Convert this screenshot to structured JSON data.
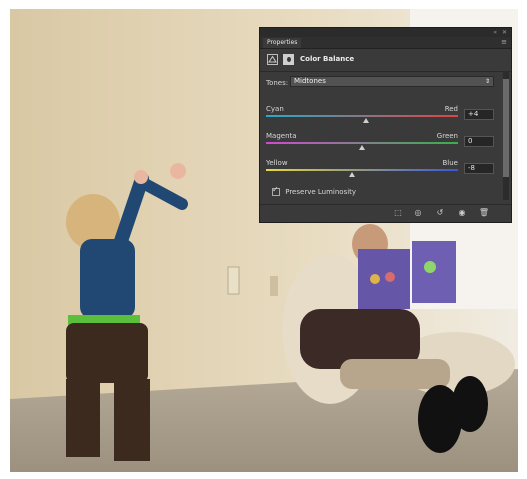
{
  "panel": {
    "tab_label": "Properties",
    "title": "Color Balance",
    "tones_label": "Tones:",
    "tones_value": "Midtones",
    "sliders": [
      {
        "left": "Cyan",
        "right": "Red",
        "value": "+4",
        "position": 0.52
      },
      {
        "left": "Magenta",
        "right": "Green",
        "value": "0",
        "position": 0.5
      },
      {
        "left": "Yellow",
        "right": "Blue",
        "value": "-8",
        "position": 0.45
      }
    ],
    "preserve_label": "Preserve Luminosity",
    "preserve_checked": true
  },
  "colors": {
    "panel_bg": "#3a3a3a",
    "cyan_red": [
      "#2aa9c8",
      "#e24242"
    ],
    "magenta_green": [
      "#d14ad0",
      "#35b24a"
    ],
    "yellow_blue": [
      "#e6d93a",
      "#3b56d9"
    ]
  },
  "icons": [
    "adjustment-icon",
    "mask-icon",
    "clip-to-layer-icon",
    "view-previous-icon",
    "reset-icon",
    "visibility-icon",
    "trash-icon"
  ]
}
